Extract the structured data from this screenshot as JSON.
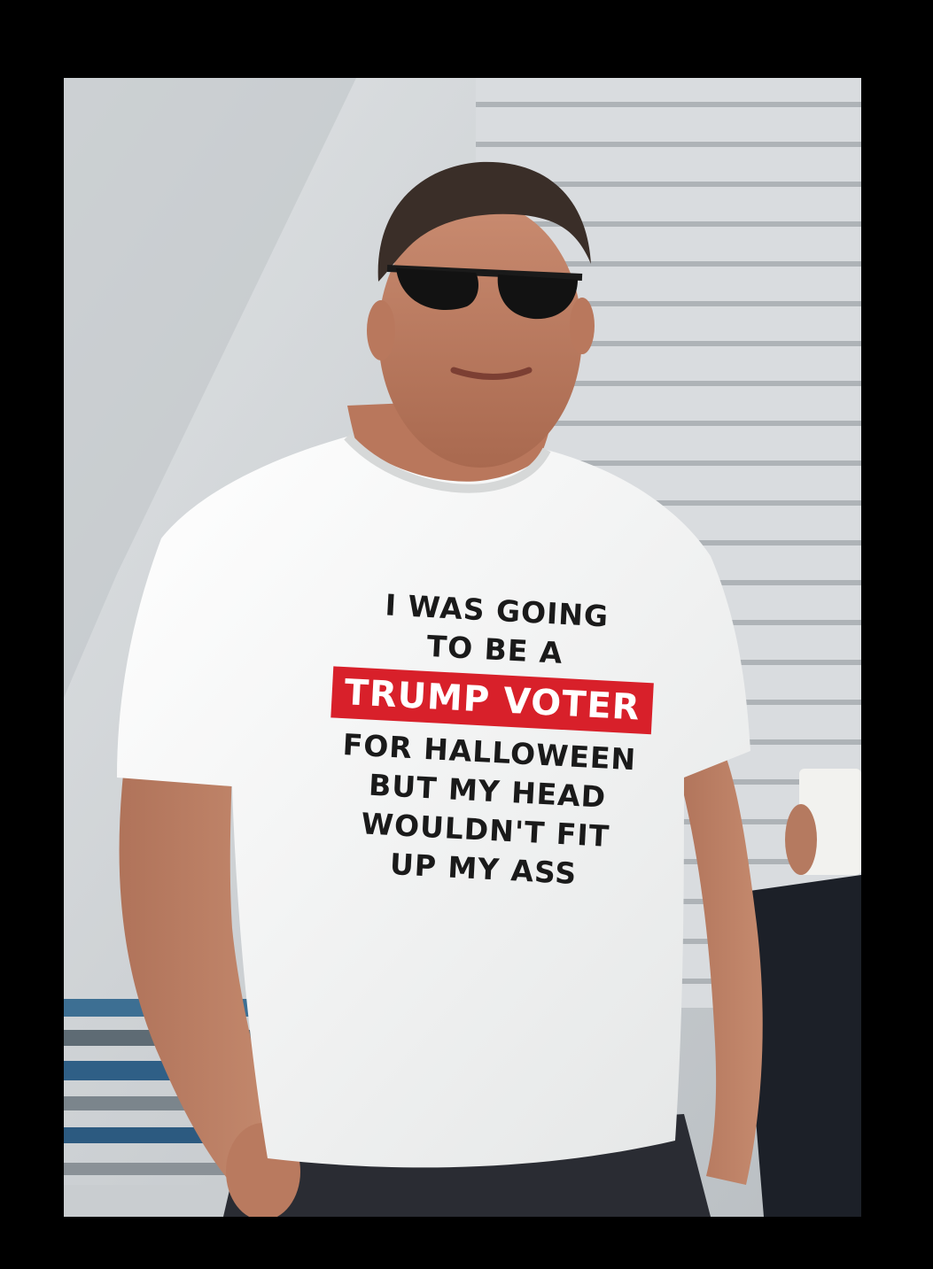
{
  "shirt": {
    "lines_before": [
      "I WAS GOING",
      "TO BE A"
    ],
    "highlight": "TRUMP VOTER",
    "lines_after": [
      "FOR HALLOWEEN",
      "BUT MY HEAD",
      "WOULDN'T FIT",
      "UP MY ASS"
    ]
  },
  "colors": {
    "frame": "#000000",
    "highlight_box": "#d8202a",
    "highlight_text": "#ffffff",
    "shirt_text": "#1a1a1a",
    "shirt": "#f6f6f4",
    "background_wall": "#cfd3d6",
    "siding": "#d9dcdf"
  }
}
